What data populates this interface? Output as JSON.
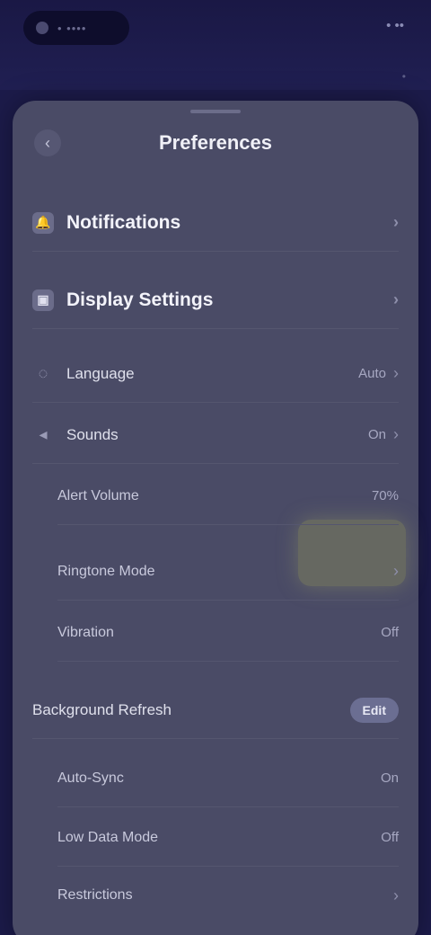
{
  "topbar": {
    "pill_text": "• ••••",
    "right_text": "• ••",
    "right_sub": "•"
  },
  "sheet": {
    "title": "Preferences",
    "subtitle": "",
    "back_icon": "chevron-left-icon"
  },
  "rows": [
    {
      "label": "Notifications",
      "value": "",
      "icon": "bell-icon"
    },
    {
      "label": "Display Settings",
      "value": "",
      "icon": "display-icon"
    },
    {
      "label": "Language",
      "value": "Auto"
    },
    {
      "label": "Sounds",
      "value": "On"
    },
    {
      "label": "Alert Volume",
      "value": "70%"
    },
    {
      "label": "Ringtone Mode",
      "value": ""
    },
    {
      "label": "Vibration",
      "value": "Off"
    }
  ],
  "section": {
    "label": "Background Refresh",
    "pill": "Edit"
  },
  "subrows": [
    {
      "label": "Auto-Sync",
      "value": "On"
    },
    {
      "label": "Low Data Mode",
      "value": "Off"
    },
    {
      "label": "Restrictions",
      "value": ""
    }
  ],
  "colors": {
    "background": "#1c1b4a",
    "sheet": "#4a4b66",
    "highlight": "#9aa05a"
  }
}
